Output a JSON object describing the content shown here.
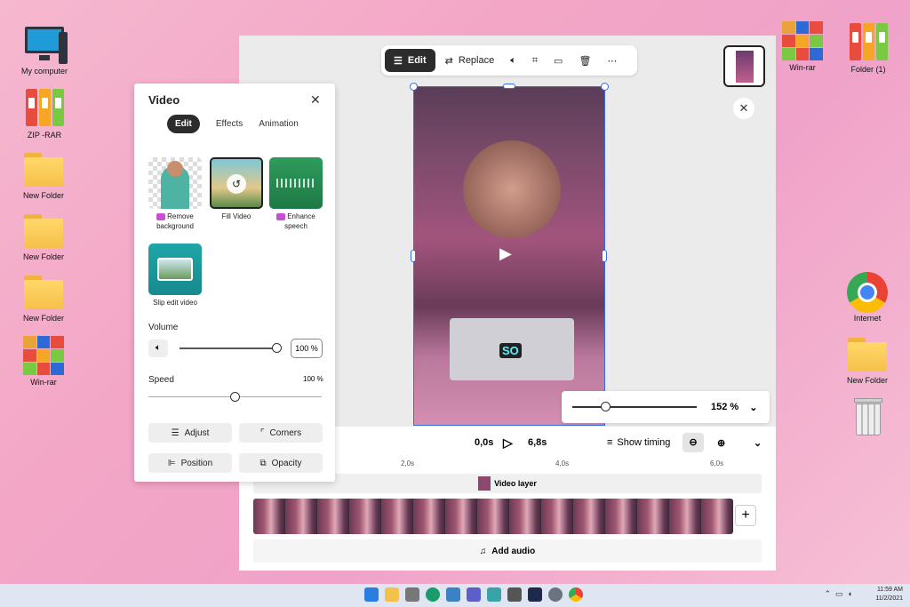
{
  "desktop": {
    "left_icons": [
      "My computer",
      "ZIP -RAR",
      "New Folder",
      "New Folder",
      "New Folder",
      "Win-rar"
    ],
    "right_icons": [
      "Win-rar",
      "Folder (1)",
      "Internet",
      "New Folder"
    ]
  },
  "toolbar": {
    "edit": "Edit",
    "replace": "Replace"
  },
  "panel": {
    "title": "Video",
    "tabs": [
      "Edit",
      "Effects",
      "Animation"
    ],
    "features": [
      {
        "label1": "Remove",
        "label2": "background",
        "premium": true
      },
      {
        "label1": "Fill Video",
        "label2": "",
        "premium": false
      },
      {
        "label1": "Enhance",
        "label2": "speech",
        "premium": true
      },
      {
        "label1": "Slip edit video",
        "label2": "",
        "premium": false
      }
    ],
    "volume_label": "Volume",
    "volume_value": "100 %",
    "volume_level": 1.0,
    "speed_label": "Speed",
    "speed_value": "100 %",
    "speed_level": 0.5,
    "buttons": [
      "Adjust",
      "Corners",
      "Position",
      "Opacity"
    ]
  },
  "video": {
    "caption": "SO"
  },
  "zoom": {
    "value": "152 %",
    "level": 0.27
  },
  "timeline": {
    "current": "0,0s",
    "duration": "6,8s",
    "show_timing": "Show timing",
    "ruler": [
      "2,0s",
      "4,0s",
      "6,0s"
    ],
    "track_label": "Video layer",
    "add_audio": "Add audio"
  },
  "taskbar": {
    "time": "11:59 AM",
    "date": "11/2/2021"
  }
}
